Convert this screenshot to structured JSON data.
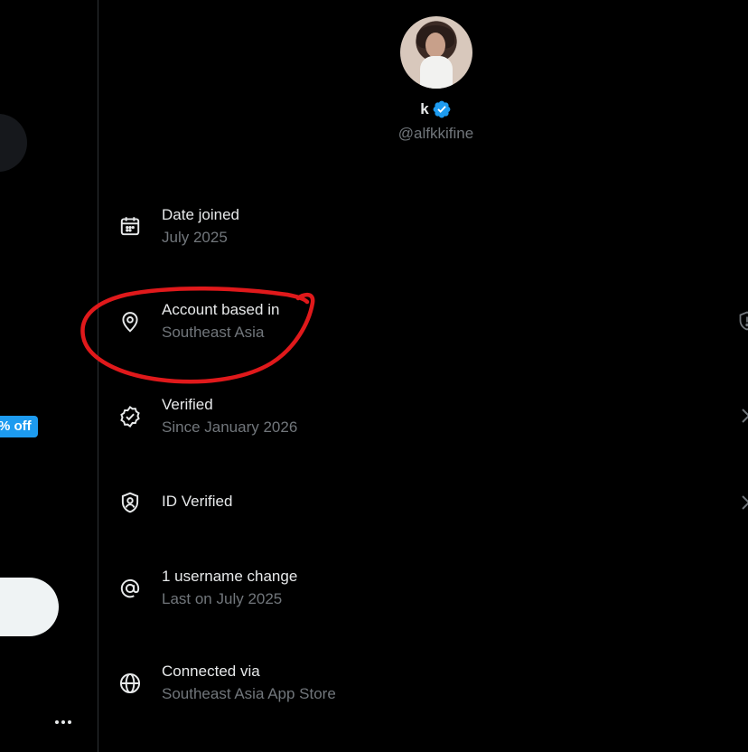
{
  "sidebar": {
    "badge_label": "% off",
    "more_icon": "more-horizontal-icon"
  },
  "profile": {
    "display_name": "k",
    "handle": "@alfkkifine",
    "verified_color": "#1d9bf0"
  },
  "about": {
    "items": [
      {
        "icon": "calendar-icon",
        "title": "Date joined",
        "subtitle": "July 2025"
      },
      {
        "icon": "location-pin-icon",
        "title": "Account based in",
        "subtitle": "Southeast Asia",
        "trailing_icon": "shield-alert-icon"
      },
      {
        "icon": "verified-check-icon",
        "title": "Verified",
        "subtitle": "Since January 2026",
        "trailing_icon": "chevron-right-icon"
      },
      {
        "icon": "id-shield-icon",
        "title": "ID Verified",
        "trailing_icon": "chevron-right-icon"
      },
      {
        "icon": "at-sign-icon",
        "title": "1 username change",
        "subtitle": "Last on July 2025"
      },
      {
        "icon": "globe-icon",
        "title": "Connected via",
        "subtitle": "Southeast Asia App Store"
      }
    ]
  },
  "annotation": {
    "color": "#e0191b",
    "shape": "hand-drawn-circle"
  },
  "colors": {
    "background": "#000000",
    "primary_text": "#e7e9ea",
    "secondary_text": "#71767b",
    "accent": "#1d9bf0"
  }
}
